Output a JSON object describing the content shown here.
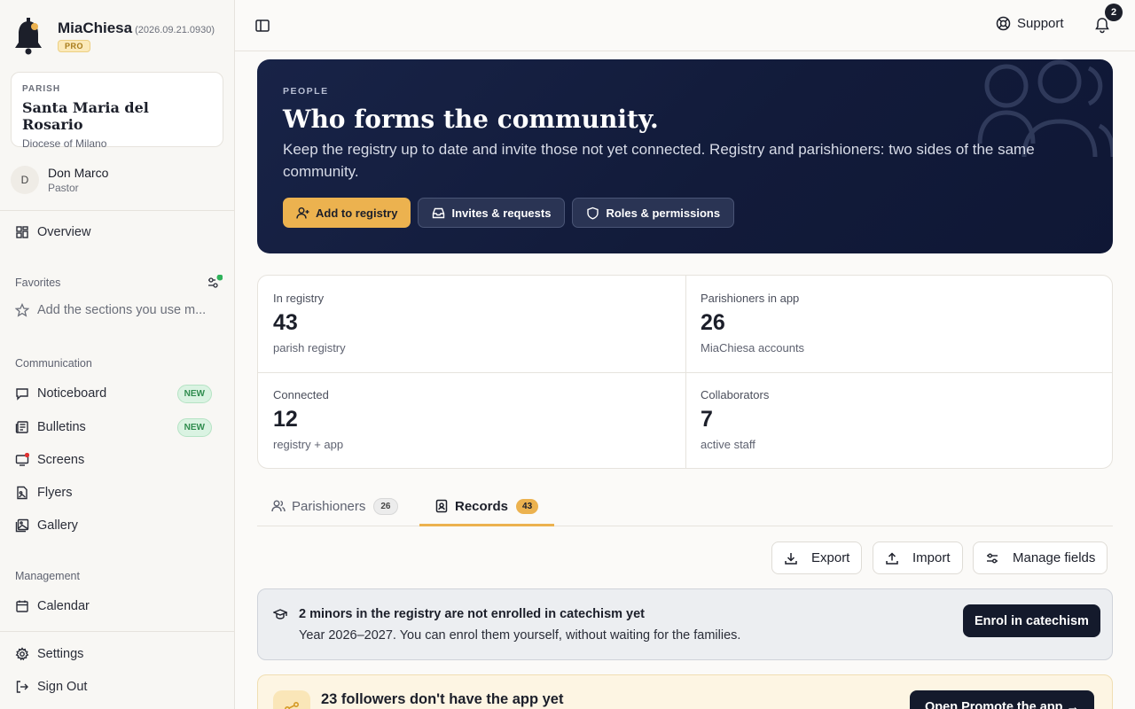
{
  "brand": {
    "name": "MiaChiesa",
    "version": "(2026.09.21.0930)",
    "plan": "PRO"
  },
  "parish": {
    "label": "PARISH",
    "name": "Santa Maria del Rosario",
    "diocese": "Diocese of Milano"
  },
  "user": {
    "initial": "D",
    "name": "Don Marco",
    "role": "Pastor"
  },
  "sidebar": {
    "overview": "Overview",
    "favorites_title": "Favorites",
    "favorites_hint": "Add the sections you use m...",
    "communication_title": "Communication",
    "communication": [
      {
        "label": "Noticeboard",
        "badge": "NEW"
      },
      {
        "label": "Bulletins",
        "badge": "NEW"
      },
      {
        "label": "Screens"
      },
      {
        "label": "Flyers"
      },
      {
        "label": "Gallery"
      }
    ],
    "management_title": "Management",
    "calendar": "Calendar",
    "settings": "Settings",
    "signout": "Sign Out"
  },
  "topbar": {
    "support": "Support",
    "notifications": "2"
  },
  "hero": {
    "eyebrow": "PEOPLE",
    "title": "Who forms the community.",
    "subtitle": "Keep the registry up to date and invite those not yet connected. Registry and parishioners: two sides of the same community.",
    "buttons": {
      "add": "Add to registry",
      "invites": "Invites & requests",
      "roles": "Roles & permissions"
    }
  },
  "stats": [
    {
      "label": "In registry",
      "value": "43",
      "sub": "parish registry"
    },
    {
      "label": "Parishioners in app",
      "value": "26",
      "sub": "MiaChiesa accounts"
    },
    {
      "label": "Connected",
      "value": "12",
      "sub": "registry + app"
    },
    {
      "label": "Collaborators",
      "value": "7",
      "sub": "active staff"
    }
  ],
  "tabs": [
    {
      "label": "Parishioners",
      "count": "26"
    },
    {
      "label": "Records",
      "count": "43"
    }
  ],
  "toolbar": {
    "export": "Export",
    "import": "Import",
    "manage": "Manage fields"
  },
  "alert": {
    "title": "2 minors in the registry are not enrolled in catechism yet",
    "text": "Year 2026–2027. You can enrol them yourself, without waiting for the families.",
    "button": "Enrol in catechism"
  },
  "promo": {
    "title": "23 followers don't have the app yet",
    "button": "Open Promote the app →"
  },
  "colors": {
    "accent": "#ecb24f",
    "hero": "#121b3a",
    "success": "#2f8c4e",
    "dot": "#e03131"
  }
}
